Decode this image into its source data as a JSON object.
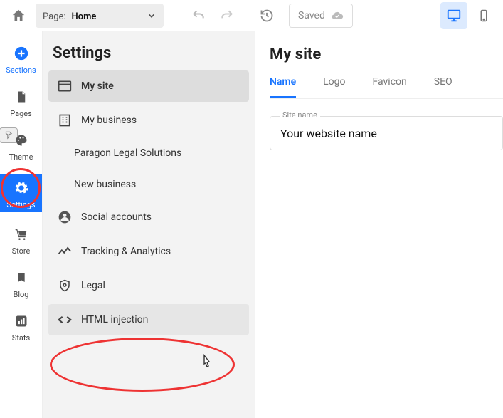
{
  "topbar": {
    "page_label": "Page:",
    "page_current": "Home",
    "saved_label": "Saved"
  },
  "rail": {
    "sections": "Sections",
    "pages": "Pages",
    "theme": "Theme",
    "settings": "Settings",
    "store": "Store",
    "blog": "Blog",
    "stats": "Stats"
  },
  "settings_panel": {
    "title": "Settings",
    "items": {
      "my_site": "My site",
      "my_business": "My business",
      "biz1": "Paragon Legal Solutions",
      "biz2": "New business",
      "social": "Social accounts",
      "tracking": "Tracking & Analytics",
      "legal": "Legal",
      "html": "HTML injection"
    }
  },
  "content": {
    "title": "My site",
    "tabs": {
      "name": "Name",
      "logo": "Logo",
      "favicon": "Favicon",
      "seo": "SEO"
    },
    "field_legend": "Site name",
    "site_name_value": "Your website name"
  }
}
